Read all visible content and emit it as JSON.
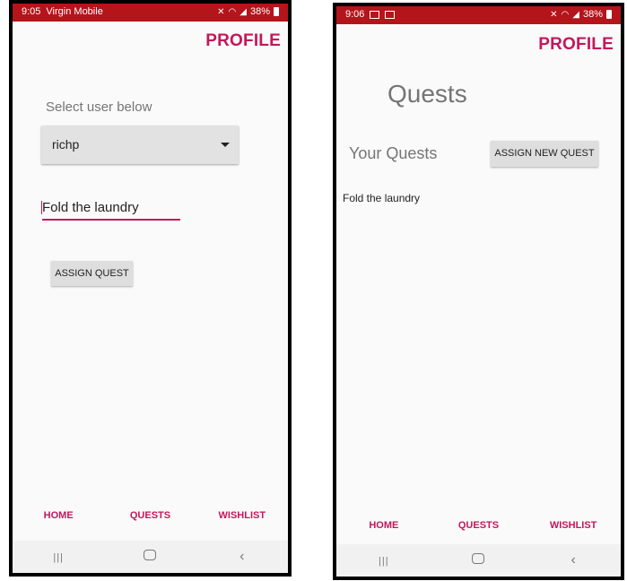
{
  "left": {
    "status": {
      "time": "9:05",
      "carrier": "Virgin Mobile",
      "battery": "38%"
    },
    "profile_label": "PROFILE",
    "select_label": "Select user below",
    "selected_user": "richp",
    "quest_input_value": "Fold the laundry",
    "assign_quest_label": "ASSIGN QUEST",
    "nav": [
      "HOME",
      "QUESTS",
      "WISHLIST"
    ]
  },
  "right": {
    "status": {
      "time": "9:06",
      "battery": "38%"
    },
    "profile_label": "PROFILE",
    "title": "Quests",
    "your_quests_label": "Your Quests",
    "assign_new_label": "ASSIGN NEW QUEST",
    "quests": [
      "Fold the laundry"
    ],
    "nav": [
      "HOME",
      "QUESTS",
      "WISHLIST"
    ]
  },
  "colors": {
    "status_bar": "#b3151b",
    "accent": "#c2185b"
  },
  "icons": [
    "mute-icon",
    "wifi-icon",
    "signal-icon",
    "battery-icon",
    "recents-icon",
    "home-icon",
    "back-icon"
  ]
}
